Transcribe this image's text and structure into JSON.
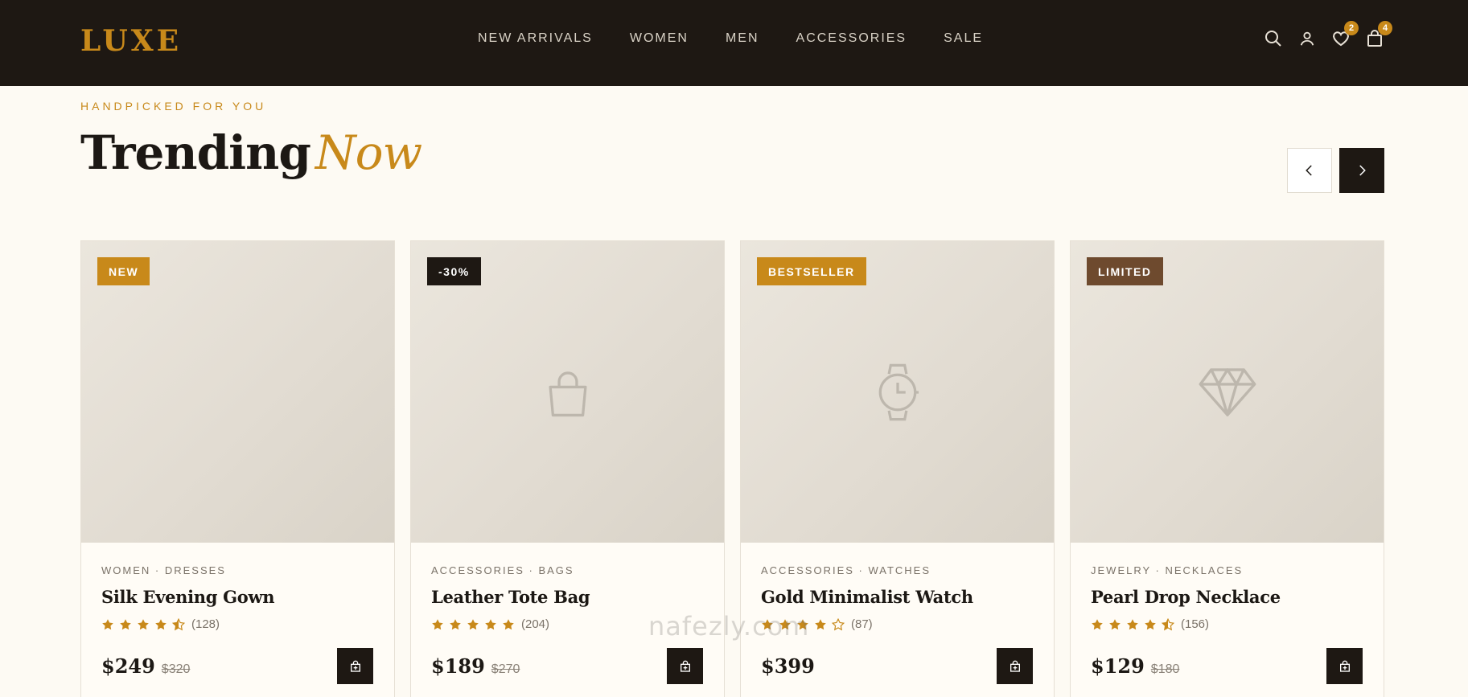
{
  "brand": {
    "logo": "LUXE",
    "accent": "#c8891a",
    "dark": "#1e1813"
  },
  "nav": [
    "NEW ARRIVALS",
    "WOMEN",
    "MEN",
    "ACCESSORIES",
    "SALE"
  ],
  "header_icons": {
    "search": "search-icon",
    "account": "user-icon",
    "wishlist": {
      "icon": "heart-icon",
      "count": "2"
    },
    "cart": {
      "icon": "shopping-bag-icon",
      "count": "4"
    }
  },
  "section": {
    "eyebrow": "HANDPICKED FOR YOU",
    "title_main": "Trending",
    "title_accent": "Now"
  },
  "carousel": {
    "prev": "chevron-left-icon",
    "next": "chevron-right-icon"
  },
  "products": [
    {
      "tag": "NEW",
      "tag_color": "#c8891a",
      "category": "WOMEN · DRESSES",
      "name": "Silk Evening Gown",
      "rating": 4.5,
      "reviews": "(128)",
      "price": "$249",
      "old_price": "$320",
      "image_icon": ""
    },
    {
      "tag": "-30%",
      "tag_color": "#1e1813",
      "category": "ACCESSORIES · BAGS",
      "name": "Leather Tote Bag",
      "rating": 5,
      "reviews": "(204)",
      "price": "$189",
      "old_price": "$270",
      "image_icon": "handbag-icon"
    },
    {
      "tag": "BESTSELLER",
      "tag_color": "#c8891a",
      "category": "ACCESSORIES · WATCHES",
      "name": "Gold Minimalist Watch",
      "rating": 4,
      "reviews": "(87)",
      "price": "$399",
      "old_price": "",
      "image_icon": "watch-icon"
    },
    {
      "tag": "LIMITED",
      "tag_color": "#6e4a2e",
      "category": "JEWELRY · NECKLACES",
      "name": "Pearl Drop Necklace",
      "rating": 4.5,
      "reviews": "(156)",
      "price": "$129",
      "old_price": "$180",
      "image_icon": "diamond-icon"
    }
  ],
  "watermark": "nafezly.com"
}
